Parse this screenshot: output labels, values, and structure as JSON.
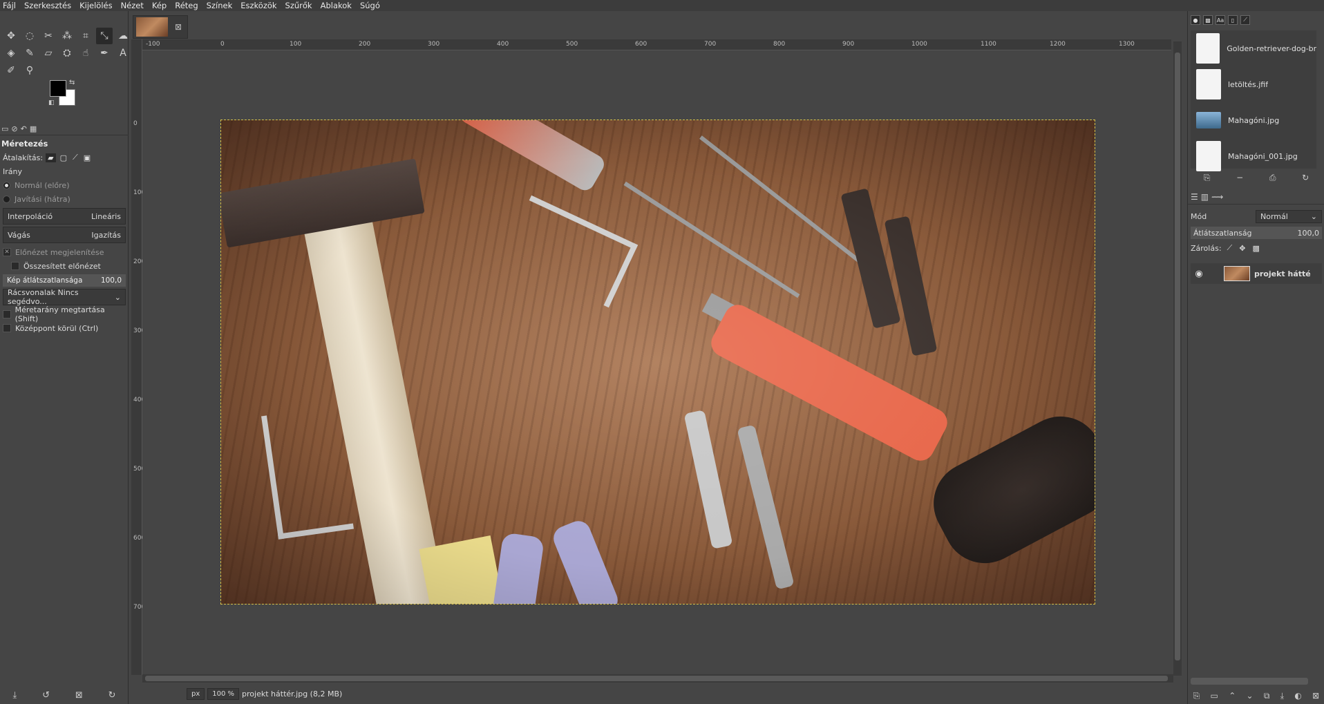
{
  "menu": [
    "Fájl",
    "Szerkesztés",
    "Kijelölés",
    "Nézet",
    "Kép",
    "Réteg",
    "Színek",
    "Eszközök",
    "Szűrők",
    "Ablakok",
    "Súgó"
  ],
  "tool_options": {
    "title": "Méretezés",
    "transform_label": "Átalakítás:",
    "direction_label": "Irány",
    "dir_normal": "Normál (előre)",
    "dir_corrective": "Javítási (hátra)",
    "interp_label": "Interpoláció",
    "interp_value": "Lineáris",
    "clip_label": "Vágás",
    "clip_value": "Igazítás",
    "show_preview": "Előnézet megjelenítése",
    "composited_preview": "Összesített előnézet",
    "image_opacity_label": "Kép átlátszatlansága",
    "image_opacity_value": "100,0",
    "guides_label": "Rácsvonalak",
    "guides_value": "Nincs segédvo...",
    "keep_aspect": "Méretarány megtartása (Shift)",
    "around_center": "Középpont körül (Ctrl)"
  },
  "ruler": {
    "h_labels": [
      "-100",
      "0",
      "100",
      "200",
      "300",
      "400",
      "500",
      "600",
      "700",
      "800",
      "900",
      "1000",
      "1100",
      "1200",
      "1300"
    ],
    "v_labels": [
      "0",
      "100",
      "200",
      "300",
      "400",
      "500",
      "600",
      "700"
    ]
  },
  "status": {
    "unit": "px",
    "zoom": "100 %",
    "info": "projekt háttér.jpg (8,2 MB)"
  },
  "documents": [
    {
      "name": "Golden-retriever-dog-bre",
      "kind": "doc"
    },
    {
      "name": "letöltés.jfif",
      "kind": "doc"
    },
    {
      "name": "Mahagóni.jpg",
      "kind": "img"
    },
    {
      "name": "Mahagóni_001.jpg",
      "kind": "doc"
    }
  ],
  "layers_panel": {
    "mode_label": "Mód",
    "mode_value": "Normál",
    "opacity_label": "Átlátszatlanság",
    "opacity_value": "100,0",
    "lock_label": "Zárolás:",
    "layer_name": "projekt hátté"
  }
}
